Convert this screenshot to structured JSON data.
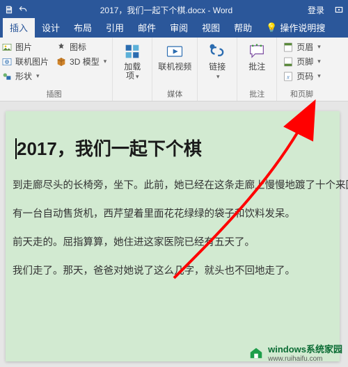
{
  "titlebar": {
    "title": "2017，我们一起下个棋.docx - Word",
    "login": "登录"
  },
  "tabs": {
    "insert": "插入",
    "design": "设计",
    "layout": "布局",
    "references": "引用",
    "mailings": "邮件",
    "review": "审阅",
    "view": "视图",
    "help": "帮助",
    "tell": "操作说明搜"
  },
  "ribbon": {
    "illustrations": {
      "pictures": "图片",
      "online_pictures": "联机图片",
      "shapes": "形状",
      "icons": "图标",
      "threeD": "3D 模型",
      "group_label": "插图"
    },
    "addins": {
      "label_top": "加载",
      "label_bottom": "项",
      "group_label": ""
    },
    "media": {
      "online_video": "联机视频",
      "group_label": "媒体"
    },
    "links": {
      "label": "链接",
      "group_label": ""
    },
    "comments": {
      "label": "批注",
      "group_label": "批注"
    },
    "header_footer": {
      "header": "页眉",
      "footer": "页脚",
      "page_number": "页码",
      "group_label": "和页脚"
    }
  },
  "document": {
    "title": "2017，我们一起下个棋",
    "p1": "到走廊尽头的长椅旁，坐下。此前，她已经在这条走廊上慢慢地踱了十个来回。",
    "p2": "有一台自动售货机，西芹望着里面花花绿绿的袋子和饮料发呆。",
    "p3": "前天走的。屈指算算，她住进这家医院已经有五天了。",
    "p4": "我们走了。那天，爸爸对她说了这么几字，就头也不回地走了。"
  },
  "watermark": {
    "brand": "windows系统家园",
    "url": "www.ruihaifu.com"
  },
  "colors": {
    "brand": "#2b579a",
    "page_bg": "#d2ead1",
    "accent_arrow": "#ff0000"
  }
}
